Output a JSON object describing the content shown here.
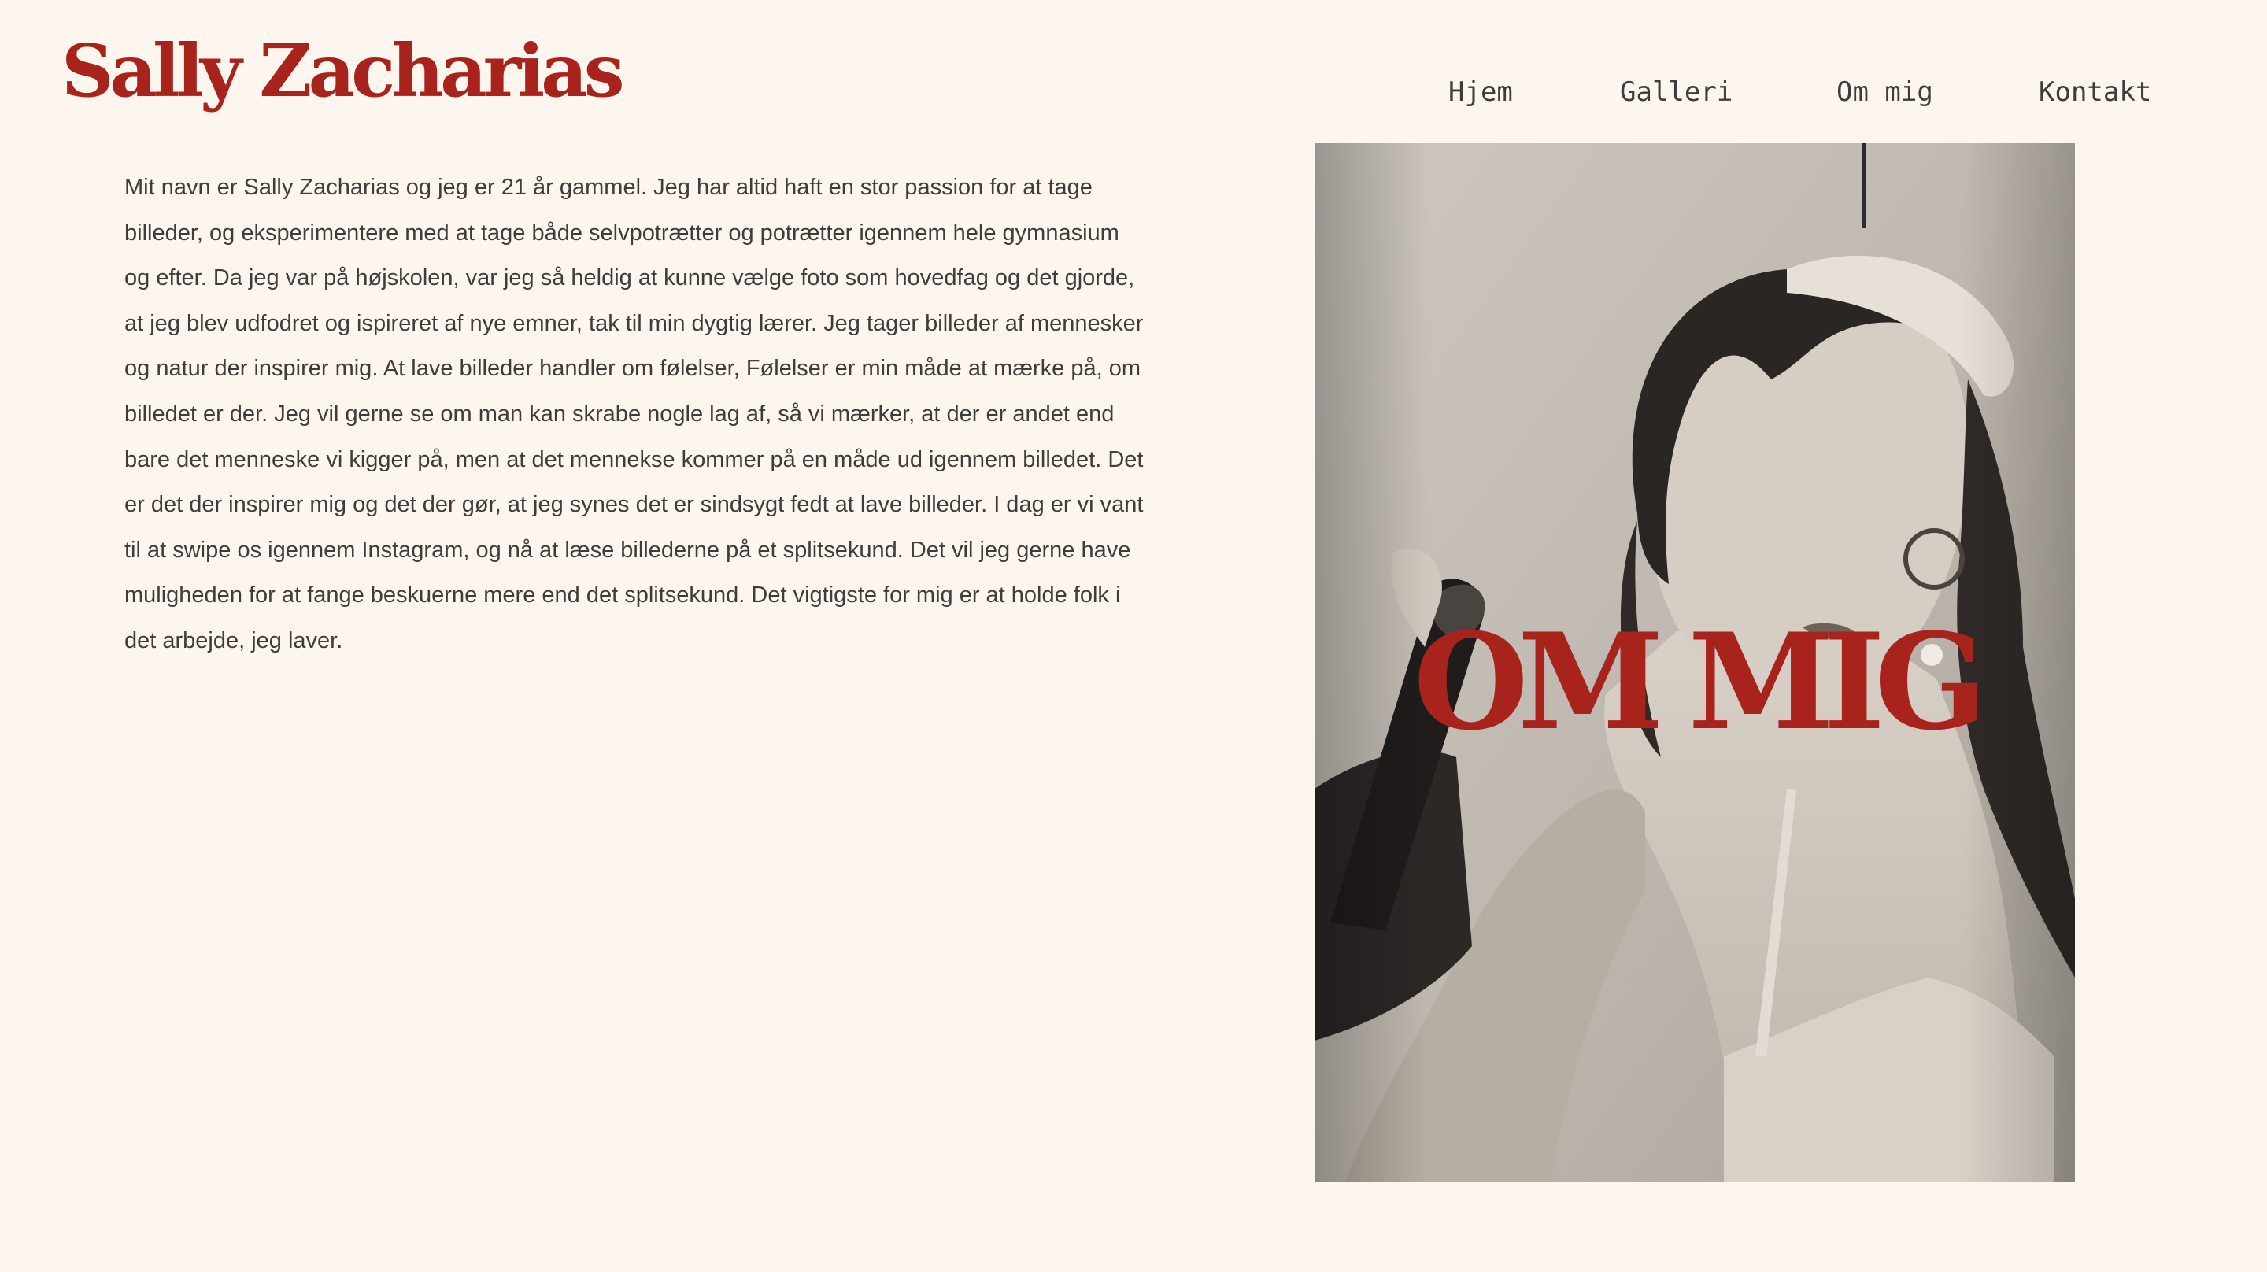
{
  "site": {
    "title": "Sally Zacharias"
  },
  "nav": {
    "items": [
      {
        "label": "Hjem"
      },
      {
        "label": "Galleri"
      },
      {
        "label": "Om mig"
      },
      {
        "label": "Kontakt"
      }
    ]
  },
  "about": {
    "heading": "OM MIG",
    "body": "Mit navn er Sally Zacharias og jeg er 21 år gammel. Jeg har altid haft en stor passion for at tage billeder, og eksperimentere med at tage både selvpotrætter og potrætter igennem hele gymnasium og efter. Da jeg var på højskolen, var jeg så heldig at kunne vælge foto som hovedfag og det gjorde, at jeg blev udfodret og ispireret af nye emner, tak til min dygtig lærer. Jeg tager billeder af mennesker og natur der inspirer mig. At lave billeder handler om følelser, Følelser er min måde at mærke på, om billedet er der. Jeg vil gerne se om man kan skrabe nogle lag af, så vi mærker, at der er andet end bare det menneske vi kigger på, men at det mennekse kommer på en måde ud igennem billedet. Det er det der inspirer mig og det der gør, at jeg synes det er sindsygt fedt at lave billeder. I dag er vi vant til at swipe os igennem Instagram, og nå at læse billederne på et splitsekund. Det vil jeg gerne have muligheden for at fange beskuerne mere end det splitsekund. Det vigtigste for mig er at holde folk i det arbejde, jeg laver."
  },
  "colors": {
    "background": "#fdf6ef",
    "accent": "#a8231c",
    "text": "#3d3d3d"
  }
}
